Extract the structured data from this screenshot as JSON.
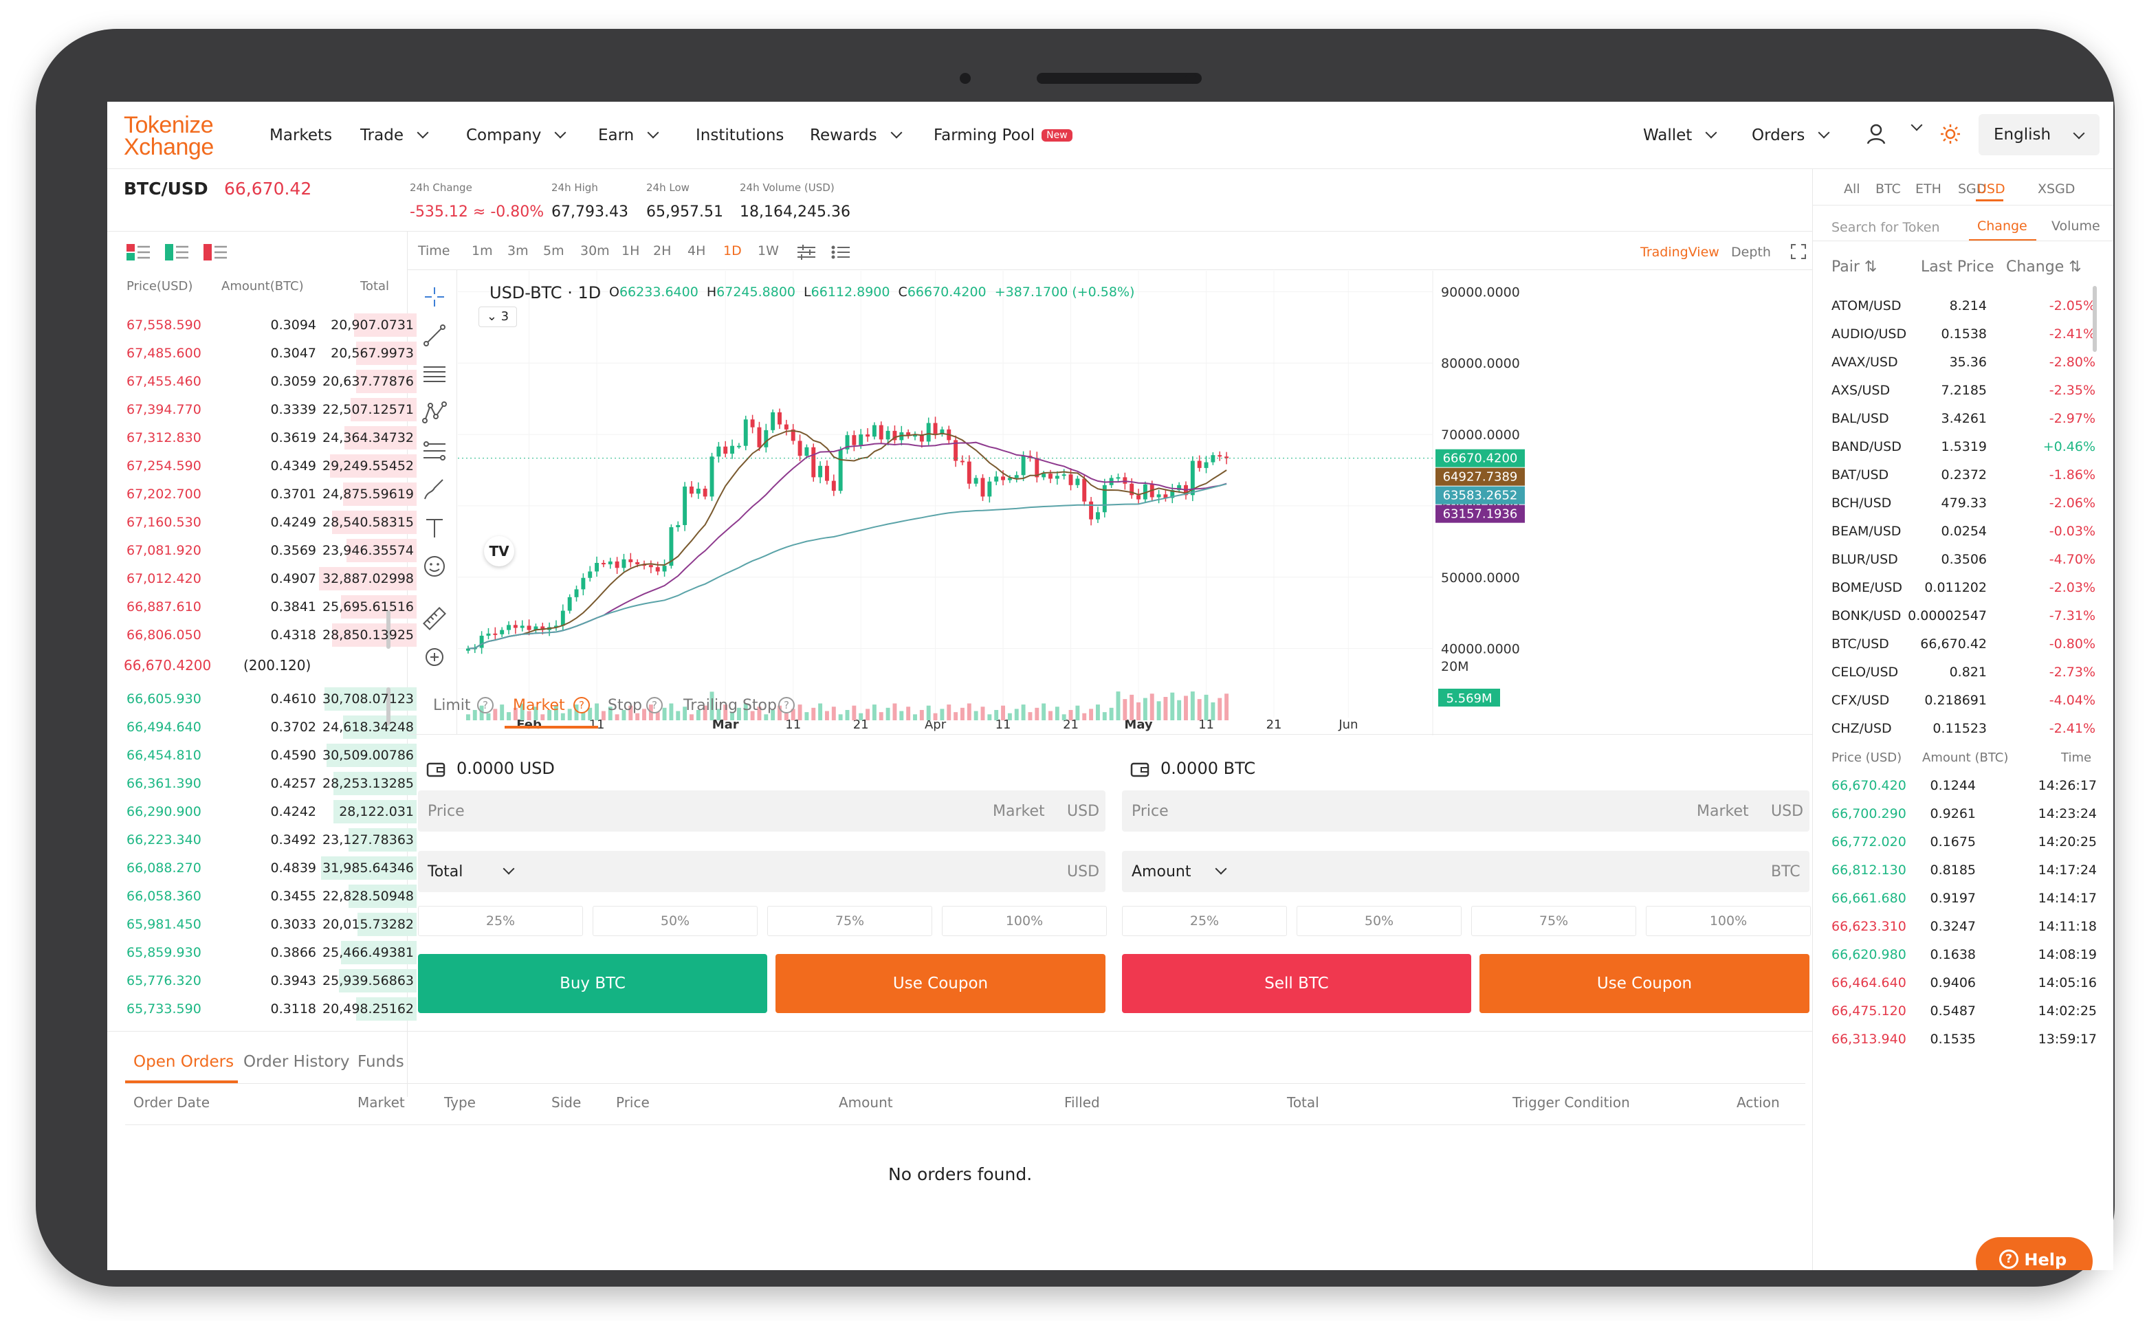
{
  "brand": {
    "line1": "Tokenize",
    "line2": "Xchange"
  },
  "nav": {
    "markets": "Markets",
    "trade": "Trade",
    "company": "Company",
    "earn": "Earn",
    "institutions": "Institutions",
    "rewards": "Rewards",
    "farming_pool": "Farming Pool",
    "new_badge": "New",
    "wallet": "Wallet",
    "orders": "Orders",
    "language": "English"
  },
  "ticker": {
    "pair": "BTC/USD",
    "price": "66,670.42",
    "change_label": "24h Change",
    "change_value": "-535.12 ≈ -0.80%",
    "high_label": "24h High",
    "high_value": "67,793.43",
    "low_label": "24h Low",
    "low_value": "65,957.51",
    "volume_label": "24h Volume (USD)",
    "volume_value": "18,164,245.36"
  },
  "orderbook": {
    "headers": {
      "price": "Price(USD)",
      "amount": "Amount(BTC)",
      "total": "Total"
    },
    "asks": [
      {
        "price": "67,558.590",
        "amount": "0.3094",
        "total": "20,907.0731",
        "depth": 0.34
      },
      {
        "price": "67,485.600",
        "amount": "0.3047",
        "total": "20,567.9973",
        "depth": 0.33
      },
      {
        "price": "67,455.460",
        "amount": "0.3059",
        "total": "20,637.77876",
        "depth": 0.33
      },
      {
        "price": "67,394.770",
        "amount": "0.3339",
        "total": "22,507.12571",
        "depth": 0.36
      },
      {
        "price": "67,312.830",
        "amount": "0.3619",
        "total": "24,364.34732",
        "depth": 0.39
      },
      {
        "price": "67,254.590",
        "amount": "0.4349",
        "total": "29,249.55452",
        "depth": 0.47
      },
      {
        "price": "67,202.700",
        "amount": "0.3701",
        "total": "24,875.59619",
        "depth": 0.4
      },
      {
        "price": "67,160.530",
        "amount": "0.4249",
        "total": "28,540.58315",
        "depth": 0.46
      },
      {
        "price": "67,081.920",
        "amount": "0.3569",
        "total": "23,946.35574",
        "depth": 0.38
      },
      {
        "price": "67,012.420",
        "amount": "0.4907",
        "total": "32,887.02998",
        "depth": 0.53
      },
      {
        "price": "66,887.610",
        "amount": "0.3841",
        "total": "25,695.61516",
        "depth": 0.41
      },
      {
        "price": "66,806.050",
        "amount": "0.4318",
        "total": "28,850.13925",
        "depth": 0.46
      }
    ],
    "mid": {
      "price": "66,670.4200",
      "spread": "(200.120)"
    },
    "bids": [
      {
        "price": "66,605.930",
        "amount": "0.4610",
        "total": "30,708.07123",
        "depth": 0.5
      },
      {
        "price": "66,494.640",
        "amount": "0.3702",
        "total": "24,618.34248",
        "depth": 0.4
      },
      {
        "price": "66,454.810",
        "amount": "0.4590",
        "total": "30,509.00786",
        "depth": 0.49
      },
      {
        "price": "66,361.390",
        "amount": "0.4257",
        "total": "28,253.13285",
        "depth": 0.45
      },
      {
        "price": "66,290.900",
        "amount": "0.4242",
        "total": "28,122.031",
        "depth": 0.45
      },
      {
        "price": "66,223.340",
        "amount": "0.3492",
        "total": "23,127.78363",
        "depth": 0.37
      },
      {
        "price": "66,088.270",
        "amount": "0.4839",
        "total": "31,985.64346",
        "depth": 0.52
      },
      {
        "price": "66,058.360",
        "amount": "0.3455",
        "total": "22,828.50948",
        "depth": 0.37
      },
      {
        "price": "65,981.450",
        "amount": "0.3033",
        "total": "20,015.73282",
        "depth": 0.32
      },
      {
        "price": "65,859.930",
        "amount": "0.3866",
        "total": "25,466.49381",
        "depth": 0.41
      },
      {
        "price": "65,776.320",
        "amount": "0.3943",
        "total": "25,939.56863",
        "depth": 0.42
      },
      {
        "price": "65,733.590",
        "amount": "0.3118",
        "total": "20,498.25162",
        "depth": 0.33
      }
    ]
  },
  "chart_toolbar": {
    "time": "Time",
    "intervals": [
      "1m",
      "3m",
      "5m",
      "30m",
      "1H",
      "2H",
      "4H",
      "1D",
      "1W"
    ],
    "active_interval": "1D",
    "tradingview": "TradingView",
    "depth": "Depth"
  },
  "chart_legend": {
    "symbol": "USD-BTC · 1D",
    "open_label": "O",
    "open": "66233.6400",
    "high_label": "H",
    "high": "67245.8800",
    "low_label": "L",
    "low": "66112.8900",
    "close_label": "C",
    "close": "66670.4200",
    "change": "+387.1700 (+0.58%)",
    "indicators_count": "3"
  },
  "chart_data": {
    "type": "candlestick",
    "symbol": "USD-BTC",
    "interval": "1D",
    "y_ticks": [
      "90000.0000",
      "80000.0000",
      "70000.0000",
      "60000.0000",
      "50000.0000",
      "40000.0000"
    ],
    "ylim": [
      39000,
      91000
    ],
    "x_ticks": [
      "Feb",
      "11",
      "Mar",
      "11",
      "21",
      "Apr",
      "11",
      "21",
      "May",
      "11",
      "21",
      "Jun"
    ],
    "start_date": "2024-01-23",
    "closes": [
      40000,
      40100,
      41800,
      42100,
      42000,
      42600,
      43300,
      42900,
      43200,
      42600,
      43100,
      42600,
      43000,
      43200,
      45300,
      47200,
      48300,
      49900,
      50800,
      52000,
      51800,
      52200,
      51300,
      52500,
      52100,
      51800,
      51700,
      51400,
      50800,
      51600,
      57000,
      57300,
      62700,
      61700,
      62400,
      61300,
      66900,
      68300,
      67300,
      68400,
      68400,
      72100,
      71000,
      68200,
      70600,
      73100,
      71400,
      70700,
      69100,
      67000,
      68200,
      64000,
      65600,
      63500,
      62100,
      67900,
      69900,
      68500,
      70000,
      69700,
      71300,
      69300,
      70500,
      69200,
      70300,
      69800,
      69900,
      69000,
      71600,
      70100,
      70700,
      69200,
      66300,
      66200,
      63100,
      63900,
      61300,
      63400,
      64100,
      63600,
      63900,
      64300,
      67000,
      66700,
      64000,
      64500,
      63800,
      64200,
      64400,
      62900,
      63800,
      60600,
      58100,
      59100,
      62900,
      63900,
      64000,
      63100,
      61500,
      60900,
      63000,
      61200,
      61600,
      61100,
      62200,
      62900,
      61500,
      66300,
      65300,
      66100,
      67100,
      66900,
      66670
    ],
    "sma_short": {
      "name": "SMA short",
      "color": "#7a5a2f"
    },
    "sma_mid": {
      "name": "SMA mid",
      "color": "#8e3a8e"
    },
    "sma_long": {
      "name": "SMA long",
      "color": "#5aa3a8"
    },
    "price_labels": [
      {
        "value": "66670.4200",
        "color": "#1db784"
      },
      {
        "value": "64927.7389",
        "color": "#8a5a24"
      },
      {
        "value": "63583.2652",
        "color": "#3fa3b0"
      },
      {
        "value": "63157.1936",
        "color": "#7b2e8a"
      }
    ],
    "volume_axis": "20M",
    "volume_label": "5.569M"
  },
  "trade_tabs": {
    "limit": "Limit",
    "market": "Market",
    "stop": "Stop",
    "trailing_stop": "Trailing Stop"
  },
  "buy": {
    "balance": "0.0000 USD",
    "price_placeholder": "Price",
    "price_mode": "Market",
    "price_unit": "USD",
    "total_label": "Total",
    "total_unit": "USD",
    "pcts": [
      "25%",
      "50%",
      "75%",
      "100%"
    ],
    "button": "Buy BTC",
    "coupon": "Use Coupon"
  },
  "sell": {
    "balance": "0.0000 BTC",
    "price_placeholder": "Price",
    "price_mode": "Market",
    "price_unit": "USD",
    "amount_label": "Amount",
    "amount_unit": "BTC",
    "pcts": [
      "25%",
      "50%",
      "75%",
      "100%"
    ],
    "button": "Sell BTC",
    "coupon": "Use Coupon"
  },
  "orders_panel": {
    "tabs": [
      "Open Orders",
      "Order History",
      "Funds"
    ],
    "columns": [
      "Order Date",
      "Market",
      "Type",
      "Side",
      "Price",
      "Amount",
      "Filled",
      "Total",
      "Trigger Condition",
      "Action"
    ],
    "empty": "No orders found."
  },
  "market_list": {
    "filters": [
      "All",
      "BTC",
      "ETH",
      "SGD",
      "USD",
      "XSGD"
    ],
    "active_filter": "USD",
    "search_placeholder": "Search for Token",
    "sort_tabs": [
      "Change",
      "Volume"
    ],
    "headers": {
      "pair": "Pair",
      "last_price": "Last Price",
      "change": "Change"
    },
    "rows": [
      {
        "pair": "ATOM/USD",
        "price": "8.214",
        "change": "-2.05%"
      },
      {
        "pair": "AUDIO/USD",
        "price": "0.1538",
        "change": "-2.41%"
      },
      {
        "pair": "AVAX/USD",
        "price": "35.36",
        "change": "-2.80%"
      },
      {
        "pair": "AXS/USD",
        "price": "7.2185",
        "change": "-2.35%"
      },
      {
        "pair": "BAL/USD",
        "price": "3.4261",
        "change": "-2.97%"
      },
      {
        "pair": "BAND/USD",
        "price": "1.5319",
        "change": "+0.46%"
      },
      {
        "pair": "BAT/USD",
        "price": "0.2372",
        "change": "-1.86%"
      },
      {
        "pair": "BCH/USD",
        "price": "479.33",
        "change": "-2.06%"
      },
      {
        "pair": "BEAM/USD",
        "price": "0.0254",
        "change": "-0.03%"
      },
      {
        "pair": "BLUR/USD",
        "price": "0.3506",
        "change": "-4.70%"
      },
      {
        "pair": "BOME/USD",
        "price": "0.011202",
        "change": "-2.03%"
      },
      {
        "pair": "BONK/USD",
        "price": "0.00002547",
        "change": "-7.31%"
      },
      {
        "pair": "BTC/USD",
        "price": "66,670.42",
        "change": "-0.80%"
      },
      {
        "pair": "CELO/USD",
        "price": "0.821",
        "change": "-2.73%"
      },
      {
        "pair": "CFX/USD",
        "price": "0.218691",
        "change": "-4.04%"
      },
      {
        "pair": "CHZ/USD",
        "price": "0.11523",
        "change": "-2.41%"
      }
    ]
  },
  "recent_trades": {
    "headers": {
      "price": "Price (USD)",
      "amount": "Amount (BTC)",
      "time": "Time"
    },
    "rows": [
      {
        "price": "66,670.420",
        "amount": "0.1244",
        "time": "14:26:17",
        "side": "buy"
      },
      {
        "price": "66,700.290",
        "amount": "0.9261",
        "time": "14:23:24",
        "side": "buy"
      },
      {
        "price": "66,772.020",
        "amount": "0.1675",
        "time": "14:20:25",
        "side": "buy"
      },
      {
        "price": "66,812.130",
        "amount": "0.8185",
        "time": "14:17:24",
        "side": "buy"
      },
      {
        "price": "66,661.680",
        "amount": "0.9197",
        "time": "14:14:17",
        "side": "buy"
      },
      {
        "price": "66,623.310",
        "amount": "0.3247",
        "time": "14:11:18",
        "side": "sell"
      },
      {
        "price": "66,620.980",
        "amount": "0.1638",
        "time": "14:08:19",
        "side": "buy"
      },
      {
        "price": "66,464.640",
        "amount": "0.9406",
        "time": "14:05:16",
        "side": "sell"
      },
      {
        "price": "66,475.120",
        "amount": "0.5487",
        "time": "14:02:25",
        "side": "sell"
      },
      {
        "price": "66,313.940",
        "amount": "0.1535",
        "time": "13:59:17",
        "side": "sell"
      }
    ]
  },
  "help": {
    "label": "Help"
  },
  "colors": {
    "accent": "#f26b1d",
    "up": "#1db784",
    "down": "#e5394a"
  }
}
